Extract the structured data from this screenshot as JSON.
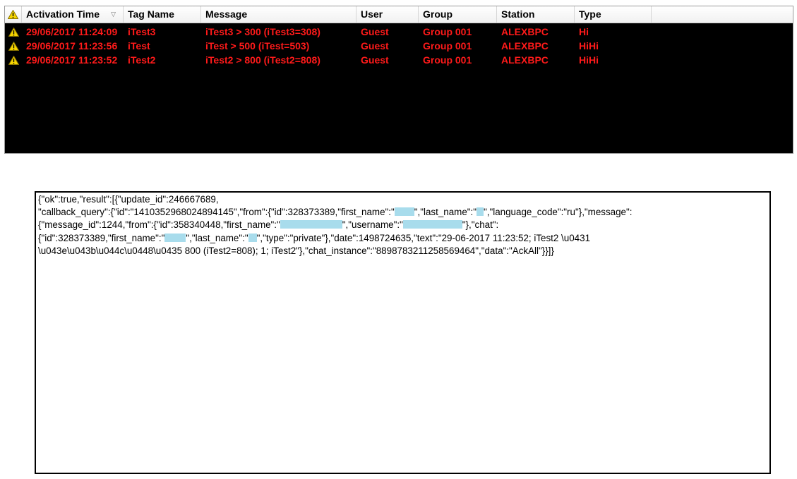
{
  "alarm_table": {
    "columns": [
      {
        "key": "icon",
        "label": ""
      },
      {
        "key": "activation_time",
        "label": "Activation Time"
      },
      {
        "key": "tag_name",
        "label": "Tag Name"
      },
      {
        "key": "message",
        "label": "Message"
      },
      {
        "key": "user",
        "label": "User"
      },
      {
        "key": "group",
        "label": "Group"
      },
      {
        "key": "station",
        "label": "Station"
      },
      {
        "key": "type",
        "label": "Type"
      }
    ],
    "sort_indicator": "▽",
    "rows": [
      {
        "icon": "warning-icon",
        "activation_time": "29/06/2017 11:24:09",
        "tag_name": "iTest3",
        "message": "iTest3 > 300 (iTest3=308)",
        "user": "Guest",
        "group": "Group 001",
        "station": "ALEXBPC",
        "type": "Hi"
      },
      {
        "icon": "warning-icon",
        "activation_time": "29/06/2017 11:23:56",
        "tag_name": "iTest",
        "message": "iTest > 500 (iTest=503)",
        "user": "Guest",
        "group": "Group 001",
        "station": "ALEXBPC",
        "type": "HiHi"
      },
      {
        "icon": "warning-icon",
        "activation_time": "29/06/2017 11:23:52",
        "tag_name": "iTest2",
        "message": "iTest2 > 800 (iTest2=808)",
        "user": "Guest",
        "group": "Group 001",
        "station": "ALEXBPC",
        "type": "HiHi"
      }
    ],
    "colors": {
      "row_text": "#ff1a1a",
      "grid_background": "#000000",
      "warning_fill": "#f5d400"
    }
  },
  "json_panel": {
    "lines": [
      [
        "{\"ok\":true,\"result\":[{\"update_id\":246667689,"
      ],
      [
        "\"callback_query\":{\"id\":\"1410352968024894145\",\"from\":{\"id\":328373389,\"first_name\":\"",
        "\",\"last_name\":\"",
        "\",\"language_code\":\"ru\"},\"message\":"
      ],
      [
        "{\"message_id\":1244,\"from\":{\"id\":358340448,\"first_name\":\"",
        "\",\"username\":\"",
        "\"},\"chat\":"
      ],
      [
        "{\"id\":328373389,\"first_name\":\"",
        "\",\"last_name\":\"",
        "\",\"type\":\"private\"},\"date\":1498724635,\"text\":\"29-06-2017 11:23:52; iTest2 \\u0431"
      ],
      [
        "\\u043e\\u043b\\u044c\\u0448\\u0435 800 (iTest2=808); 1; iTest2\"},\"chat_instance\":\"8898783211258569464\",\"data\":\"AckAll\"}}]}"
      ]
    ],
    "redaction_color": "#a8dcec"
  }
}
